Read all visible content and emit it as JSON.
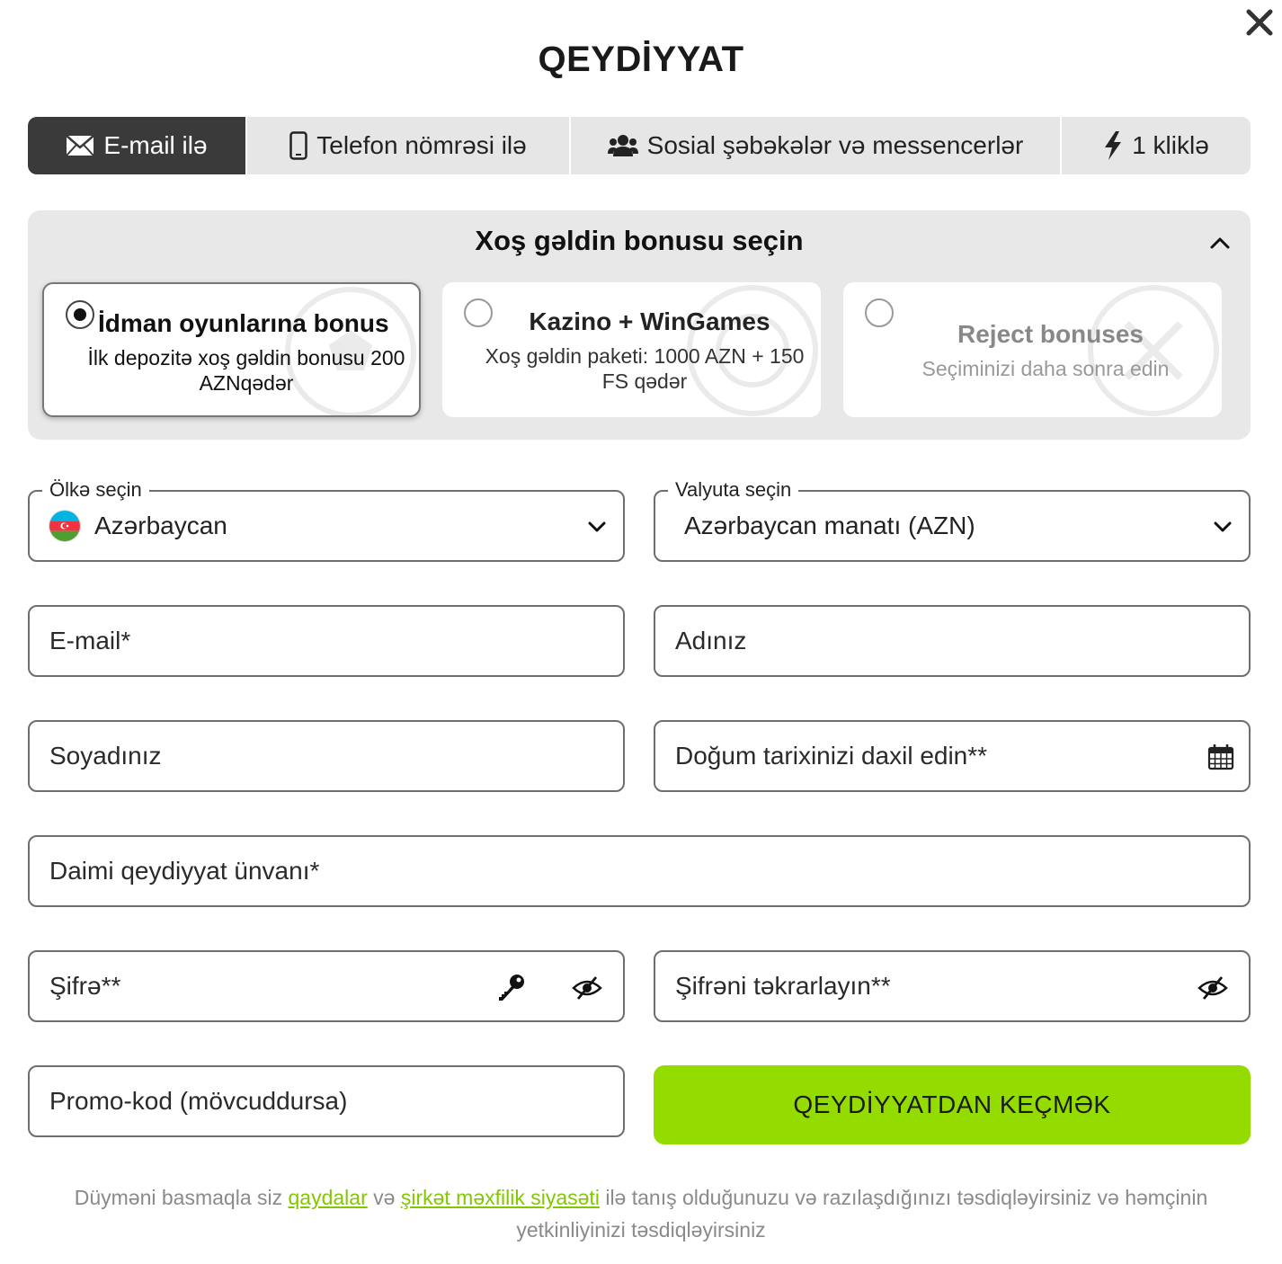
{
  "modal": {
    "title": "QEYDİYYAT"
  },
  "tabs": [
    {
      "label": "E-mail ilə",
      "icon": "envelope-icon",
      "active": true
    },
    {
      "label": "Telefon nömrəsi ilə",
      "icon": "smartphone-icon",
      "active": false
    },
    {
      "label": "Sosial şəbəkələr və messencerlər",
      "icon": "users-icon",
      "active": false
    },
    {
      "label": "1 kliklə",
      "icon": "lightning-icon",
      "active": false
    }
  ],
  "bonus": {
    "title": "Xoş gəldin bonusu seçin",
    "options": [
      {
        "name": "İdman oyunlarına bonus",
        "description": "İlk depozitə xoş gəldin bonusu 200 AZNqədər",
        "selected": true
      },
      {
        "name": "Kazino + WinGames",
        "description": "Xoş gəldin paketi: 1000 AZN + 150 FS qədər",
        "selected": false
      },
      {
        "name": "Reject bonuses",
        "description": "Seçiminizi daha sonra edin",
        "selected": false
      }
    ]
  },
  "form": {
    "country": {
      "label": "Ölkə seçin",
      "value": "Azərbaycan"
    },
    "currency": {
      "label": "Valyuta seçin",
      "value": "Azərbaycan manatı (AZN)"
    },
    "email": {
      "placeholder": "E-mail*"
    },
    "first_name": {
      "placeholder": "Adınız"
    },
    "last_name": {
      "placeholder": "Soyadınız"
    },
    "birth_date": {
      "placeholder": "Doğum tarixinizi daxil edin**"
    },
    "address": {
      "placeholder": "Daimi qeydiyyat ünvanı*"
    },
    "password": {
      "placeholder": "Şifrə**"
    },
    "password_repeat": {
      "placeholder": "Şifrəni təkrarlayın**"
    },
    "promo": {
      "placeholder": "Promo-kod (mövcuddursa)"
    },
    "submit_label": "QEYDİYYATDAN KEÇMƏK"
  },
  "terms": {
    "text_before": "Düyməni basmaqla siz ",
    "rules_link": "qaydalar",
    "and": " və ",
    "privacy_link": "şirkət məxfilik siyasəti",
    "text_after": " ilə tanış olduğunuzu və razılaşdığınızı təsdiqləyirsiniz və həmçinin yetkinliyinizi təsdiqləyirsiniz"
  },
  "colors": {
    "accent": "#94dc00",
    "link": "#82c800",
    "active_tab": "#3a3a3a",
    "panel_bg": "#e8e8e8"
  }
}
